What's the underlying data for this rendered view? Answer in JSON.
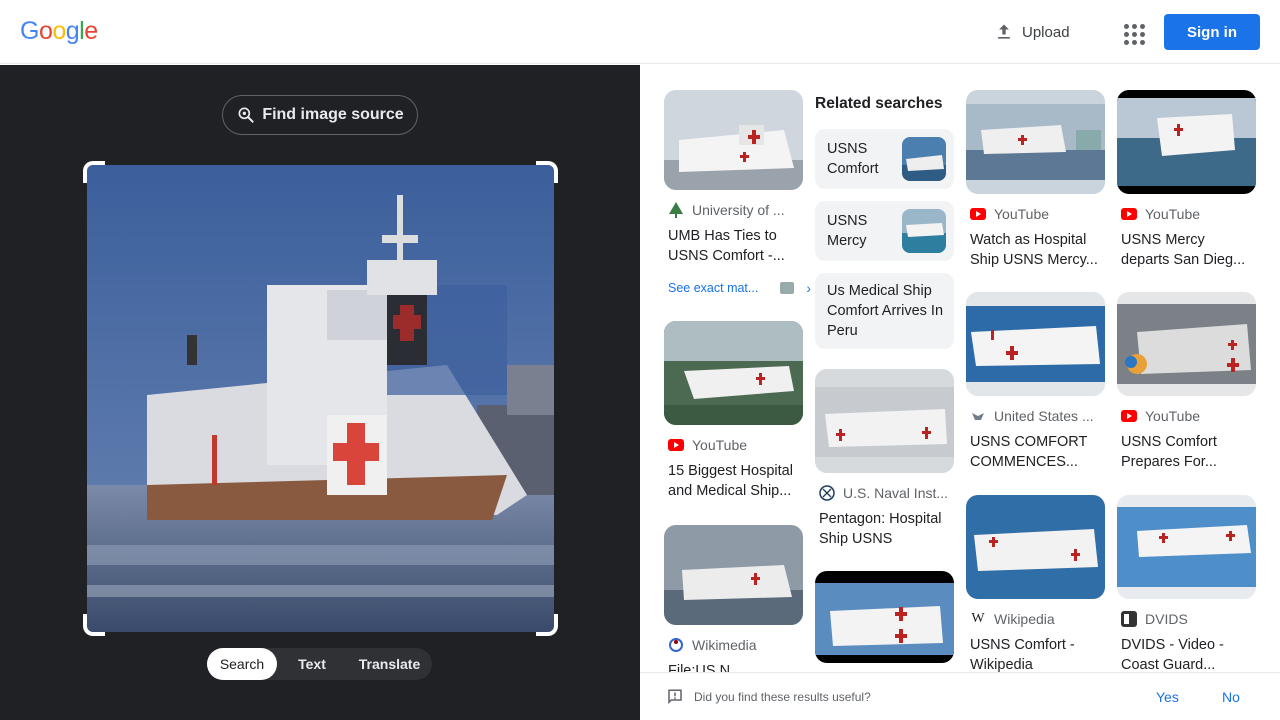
{
  "header": {
    "logo": [
      "G",
      "o",
      "o",
      "g",
      "l",
      "e"
    ],
    "upload_label": "Upload",
    "signin_label": "Sign in"
  },
  "left": {
    "find_source_label": "Find image source",
    "modes": [
      "Search",
      "Text",
      "Translate"
    ],
    "active_mode": "Search"
  },
  "results": {
    "related_heading": "Related searches",
    "related": [
      {
        "label": "USNS Comfort"
      },
      {
        "label": "USNS Mercy"
      },
      {
        "label": "Us Medical Ship Comfort Arrives In Peru"
      }
    ],
    "see_exact": "See exact mat...",
    "cards": [
      {
        "source": "University of ...",
        "title": "UMB Has Ties to USNS Comfort -...",
        "favicon": "tree-icon"
      },
      {
        "source": "YouTube",
        "title": "15 Biggest Hospital and Medical Ship...",
        "favicon": "youtube-icon"
      },
      {
        "source": "Wikimedia",
        "title": "File:US N...",
        "favicon": "wikimedia-icon"
      },
      {
        "source": "U.S. Naval Inst...",
        "title": "Pentagon: Hospital Ship USNS Comfo...",
        "favicon": "naval-icon"
      },
      {
        "source": "YouTube",
        "title": "Watch as Hospital Ship USNS Mercy...",
        "favicon": "youtube-icon"
      },
      {
        "source": "YouTube",
        "title": "USNS Mercy departs San Dieg...",
        "favicon": "youtube-icon"
      },
      {
        "source": "United States ...",
        "title": "USNS COMFORT COMMENCES...",
        "favicon": "navy-eagle-icon"
      },
      {
        "source": "YouTube",
        "title": "USNS Comfort Prepares For...",
        "favicon": "youtube-icon"
      },
      {
        "source": "Wikipedia",
        "title": "USNS Comfort - Wikipedia",
        "favicon": "wikipedia-icon"
      },
      {
        "source": "DVIDS",
        "title": "DVIDS - Video - Coast Guard...",
        "favicon": "dvids-icon"
      }
    ]
  },
  "feedback": {
    "question": "Did you find these results useful?",
    "yes": "Yes",
    "no": "No"
  },
  "colors": {
    "accent": "#1a73e8",
    "left_bg": "#202124",
    "youtube": "#ff0000"
  }
}
